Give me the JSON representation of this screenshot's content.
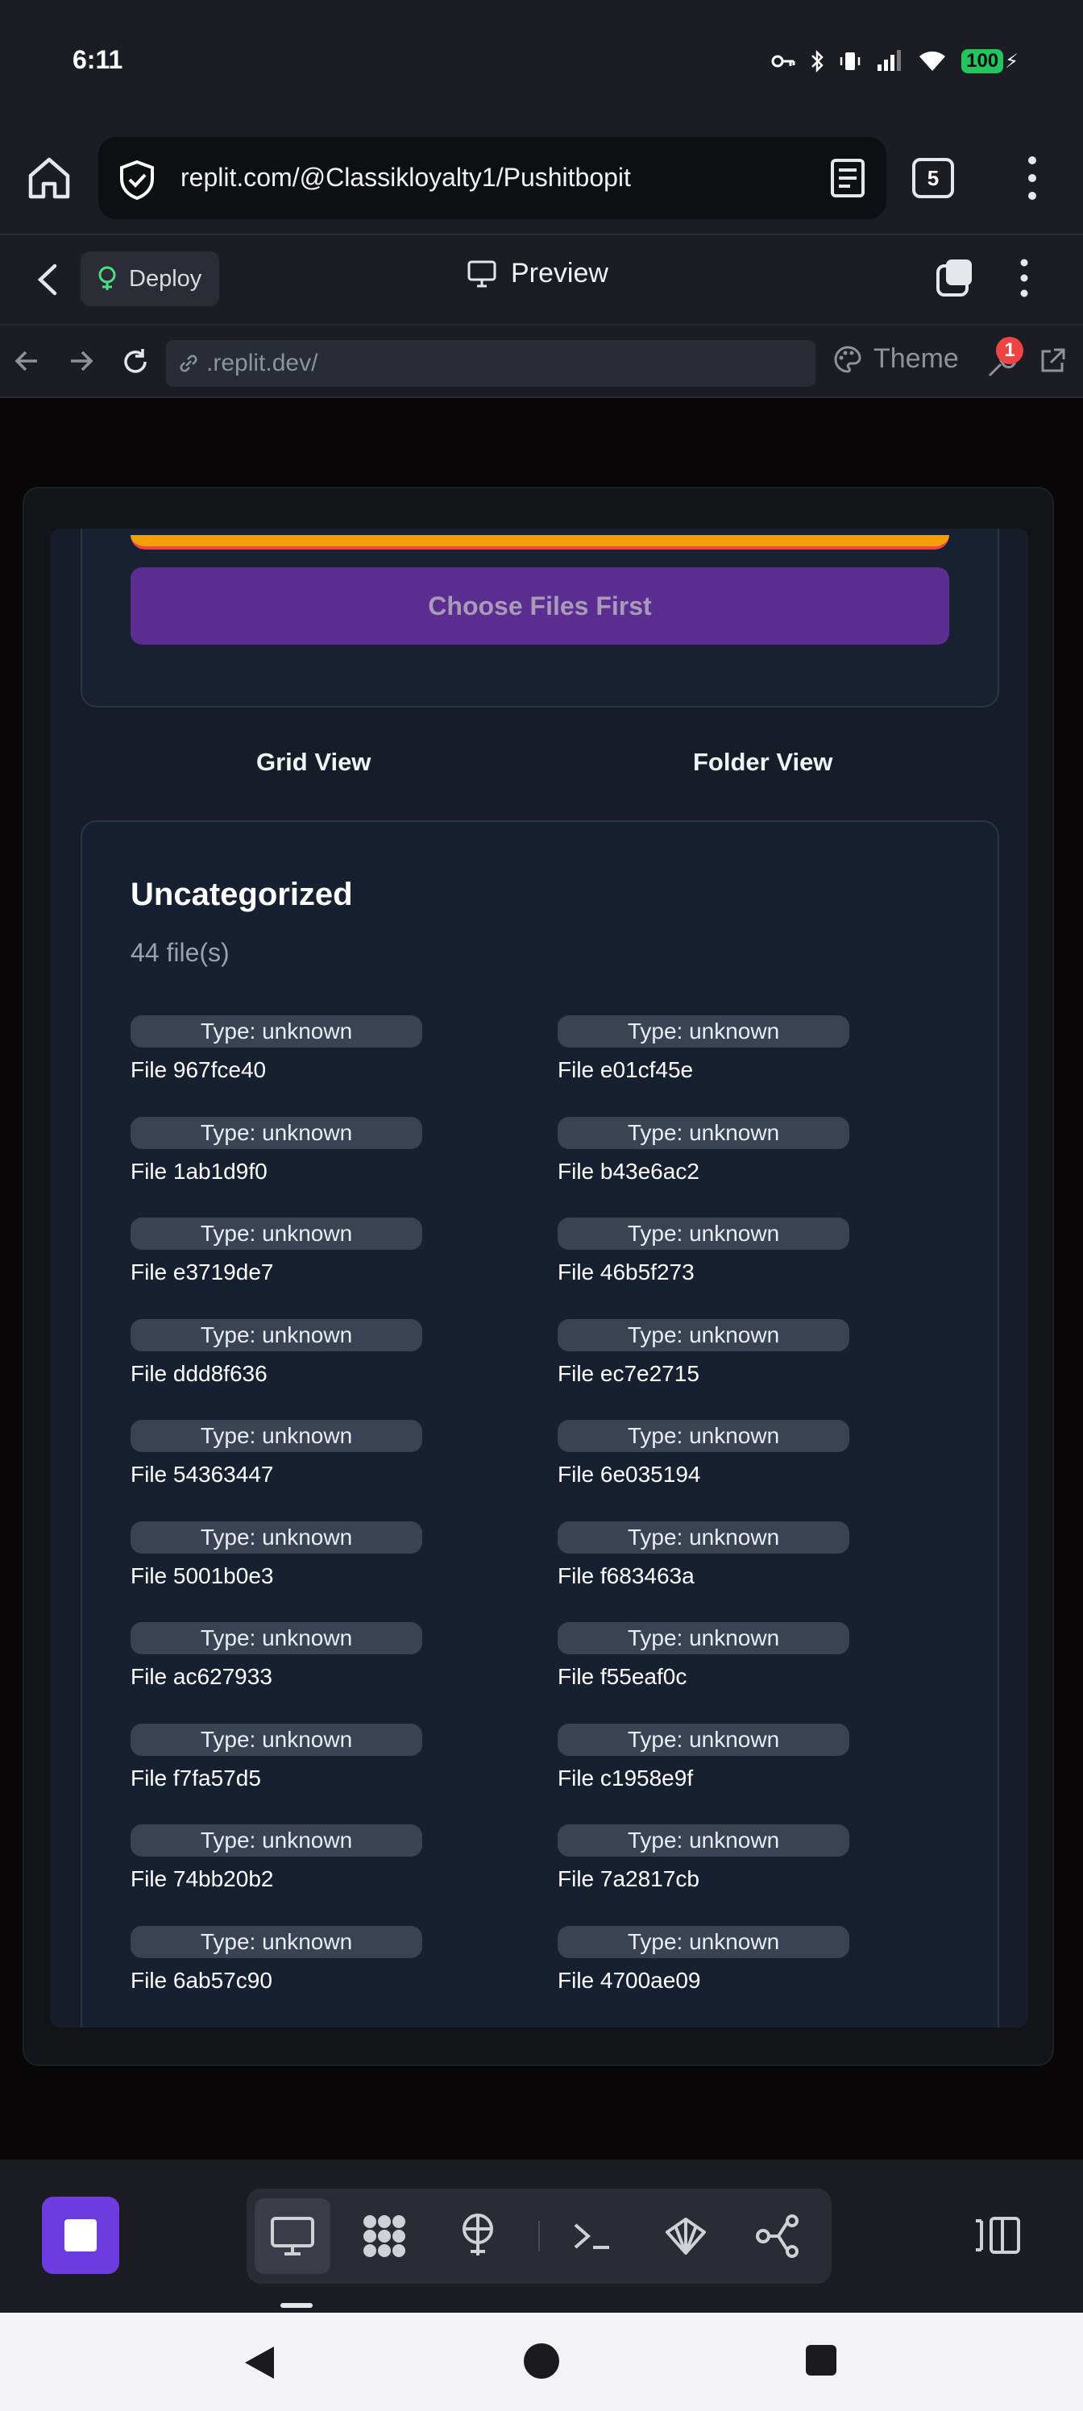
{
  "status_bar": {
    "time": "6:11",
    "battery": "100"
  },
  "browser": {
    "url": "replit.com/@Classikloyalty1/Pushitbopit",
    "tab_count": "5"
  },
  "replit_header": {
    "deploy_label": "Deploy",
    "title": "Preview"
  },
  "webview_nav": {
    "address": ".replit.dev/",
    "theme_label": "Theme",
    "devtools_badge": "1"
  },
  "page": {
    "choose_button_label": "Choose Files First",
    "view_tabs": [
      "Grid View",
      "Folder View"
    ],
    "category": {
      "title": "Uncategorized",
      "count_text": "44 file(s)"
    },
    "files": [
      {
        "type": "Type: unknown",
        "name": "File 967fce40"
      },
      {
        "type": "Type: unknown",
        "name": "File e01cf45e"
      },
      {
        "type": "Type: unknown",
        "name": "File 1ab1d9f0"
      },
      {
        "type": "Type: unknown",
        "name": "File b43e6ac2"
      },
      {
        "type": "Type: unknown",
        "name": "File e3719de7"
      },
      {
        "type": "Type: unknown",
        "name": "File 46b5f273"
      },
      {
        "type": "Type: unknown",
        "name": "File ddd8f636"
      },
      {
        "type": "Type: unknown",
        "name": "File ec7e2715"
      },
      {
        "type": "Type: unknown",
        "name": "File 54363447"
      },
      {
        "type": "Type: unknown",
        "name": "File 6e035194"
      },
      {
        "type": "Type: unknown",
        "name": "File 5001b0e3"
      },
      {
        "type": "Type: unknown",
        "name": "File f683463a"
      },
      {
        "type": "Type: unknown",
        "name": "File ac627933"
      },
      {
        "type": "Type: unknown",
        "name": "File f55eaf0c"
      },
      {
        "type": "Type: unknown",
        "name": "File f7fa57d5"
      },
      {
        "type": "Type: unknown",
        "name": "File c1958e9f"
      },
      {
        "type": "Type: unknown",
        "name": "File 74bb20b2"
      },
      {
        "type": "Type: unknown",
        "name": "File 7a2817cb"
      },
      {
        "type": "Type: unknown",
        "name": "File 6ab57c90"
      },
      {
        "type": "Type: unknown",
        "name": "File 4700ae09"
      }
    ]
  },
  "toolbar": {
    "tools": [
      "preview-icon",
      "apps-icon",
      "deploy-icon",
      "shell-icon",
      "ai-icon",
      "git-icon"
    ]
  },
  "colors": {
    "accent_purple": "#6d3be0",
    "button_purple": "#5b2d91",
    "pill_bg": "#394354",
    "battery_green": "#22c55e",
    "badge_red": "#ef4444"
  }
}
